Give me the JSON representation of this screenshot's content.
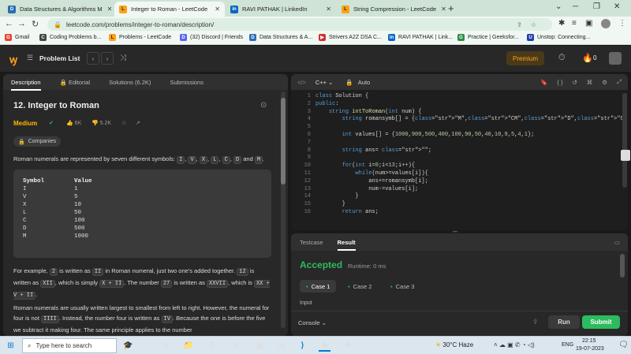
{
  "browser": {
    "tabs": [
      {
        "title": "Data Structures & Algorithms M",
        "active": false
      },
      {
        "title": "Integer to Roman - LeetCode",
        "active": true
      },
      {
        "title": "RAVI PATHAK | LinkedIn",
        "active": false
      },
      {
        "title": "String Compression - LeetCode",
        "active": false
      }
    ],
    "url": "leetcode.com/problems/integer-to-roman/description/",
    "bookmarks": [
      "Gmail",
      "Coding Problems b...",
      "Problems - LeetCode",
      "(32) Discord | Friends",
      "Data Structures & A...",
      "Strivers A2Z DSA C...",
      "RAVI PATHAK | Link...",
      "Practice | Geeksfor...",
      "Unstop: Connecting..."
    ]
  },
  "lc_header": {
    "problem_list": "Problem List",
    "premium": "Premium",
    "streak": "0"
  },
  "left": {
    "tabs": [
      "Description",
      "Editorial",
      "Solutions (6.2K)",
      "Submissions"
    ],
    "title": "12. Integer to Roman",
    "difficulty": "Medium",
    "likes": "6K",
    "dislikes": "5.2K",
    "companies": "Companies",
    "intro": [
      "Roman numerals are represented by seven different symbols: ",
      "I",
      ", ",
      "V",
      ", ",
      "X",
      ", ",
      "L",
      ", ",
      "C",
      ", ",
      "D",
      " and ",
      "M",
      "."
    ],
    "table_header": [
      "Symbol",
      "Value"
    ],
    "table": [
      [
        "I",
        "1"
      ],
      [
        "V",
        "5"
      ],
      [
        "X",
        "10"
      ],
      [
        "L",
        "50"
      ],
      [
        "C",
        "100"
      ],
      [
        "D",
        "500"
      ],
      [
        "M",
        "1000"
      ]
    ],
    "para2": [
      "For example, ",
      "2",
      " is written as ",
      "II",
      " in Roman numeral, just two one's added together. ",
      "12",
      " is written as ",
      "XII",
      ", which is simply ",
      "X + II",
      ". The number ",
      "27",
      " is written as ",
      "XXVII",
      ", which is ",
      "XX + V + II",
      "."
    ],
    "para3": "Roman numerals are usually written largest to smallest from left to right. However, the numeral for four is not ",
    "para3_code1": "IIII",
    "para3_b": ". Instead, the number four is written as ",
    "para3_code2": "IV",
    "para3_c": ". Because the one is before the five we subtract it making four. The same principle applies to the number"
  },
  "editor": {
    "language": "C++",
    "mode": "Auto",
    "lines": [
      "1",
      "2",
      "3",
      "4",
      "5",
      "6",
      "7",
      "8",
      "9",
      "10",
      "11",
      "12",
      "13",
      "14",
      "15",
      "16"
    ],
    "code": [
      "class Solution {",
      "public:",
      "    string intToRoman(int num) {",
      "        string romansymb[] = {\"M\",\"CM\",\"D\",\"CD\",\"C\",\"XC\",\"L\",\"XL\",\"X\",\"IX\",\"V\",\"IV\",\"I\"};",
      "",
      "        int values[] = {1000,900,500,400,100,90,50,40,10,9,5,4,1};",
      "",
      "        string ans= \"\";",
      "",
      "        for(int i=0;i<13;i++){",
      "            while(num>=values[i]){",
      "                ans+=romansymb[i];",
      "                num-=values[i];",
      "            }",
      "        }",
      "        return ans;"
    ]
  },
  "result": {
    "tabs": [
      "Testcase",
      "Result"
    ],
    "status": "Accepted",
    "runtime": "Runtime: 0 ms",
    "cases": [
      "Case 1",
      "Case 2",
      "Case 3"
    ],
    "input_label": "Input",
    "console": "Console",
    "run": "Run",
    "submit": "Submit"
  },
  "taskbar": {
    "search_placeholder": "Type here to search",
    "weather": "30°C  Haze",
    "lang": "ENG",
    "time": "22:15",
    "date": "19-07-2023"
  }
}
